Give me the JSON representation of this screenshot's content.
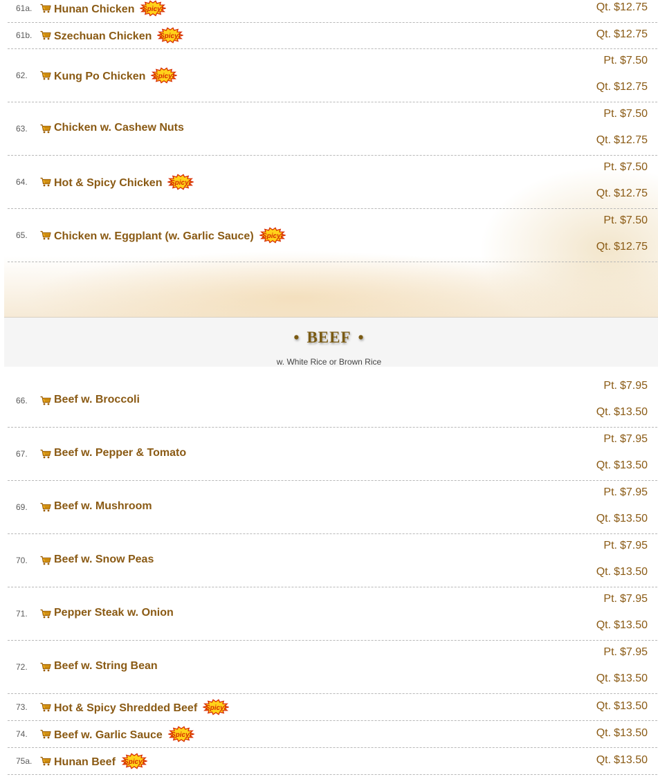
{
  "colors": {
    "item_text": "#8a5a14",
    "section_title": "#7a5a12",
    "spicy_badge": "#d62a00"
  },
  "icons": {
    "cart": "cart-icon",
    "spicy": "spicy-badge-icon"
  },
  "spicy_badge_text": "Spicy!",
  "beef_section": {
    "title": "BEEF",
    "bullet": "•",
    "subtitle": "w. White Rice or Brown Rice"
  },
  "items": [
    {
      "num": "61a.",
      "name": "Hunan Chicken",
      "spicy": true,
      "prices": [
        {
          "size": "Qt.",
          "amount": "$12.75"
        }
      ]
    },
    {
      "num": "61b.",
      "name": "Szechuan Chicken",
      "spicy": true,
      "prices": [
        {
          "size": "Qt.",
          "amount": "$12.75"
        }
      ]
    },
    {
      "num": "62.",
      "name": "Kung Po Chicken",
      "spicy": true,
      "prices": [
        {
          "size": "Pt.",
          "amount": "$7.50"
        },
        {
          "size": "Qt.",
          "amount": "$12.75"
        }
      ]
    },
    {
      "num": "63.",
      "name": "Chicken w. Cashew Nuts",
      "spicy": false,
      "prices": [
        {
          "size": "Pt.",
          "amount": "$7.50"
        },
        {
          "size": "Qt.",
          "amount": "$12.75"
        }
      ]
    },
    {
      "num": "64.",
      "name": "Hot & Spicy Chicken",
      "spicy": true,
      "prices": [
        {
          "size": "Pt.",
          "amount": "$7.50"
        },
        {
          "size": "Qt.",
          "amount": "$12.75"
        }
      ]
    },
    {
      "num": "65.",
      "name": "Chicken w. Eggplant (w. Garlic Sauce)",
      "spicy": true,
      "prices": [
        {
          "size": "Pt.",
          "amount": "$7.50"
        },
        {
          "size": "Qt.",
          "amount": "$12.75"
        }
      ]
    },
    {
      "num": "66.",
      "name": "Beef w. Broccoli",
      "spicy": false,
      "prices": [
        {
          "size": "Pt.",
          "amount": "$7.95"
        },
        {
          "size": "Qt.",
          "amount": "$13.50"
        }
      ]
    },
    {
      "num": "67.",
      "name": "Beef w. Pepper & Tomato",
      "spicy": false,
      "prices": [
        {
          "size": "Pt.",
          "amount": "$7.95"
        },
        {
          "size": "Qt.",
          "amount": "$13.50"
        }
      ]
    },
    {
      "num": "69.",
      "name": "Beef w. Mushroom",
      "spicy": false,
      "prices": [
        {
          "size": "Pt.",
          "amount": "$7.95"
        },
        {
          "size": "Qt.",
          "amount": "$13.50"
        }
      ]
    },
    {
      "num": "70.",
      "name": "Beef w. Snow Peas",
      "spicy": false,
      "prices": [
        {
          "size": "Pt.",
          "amount": "$7.95"
        },
        {
          "size": "Qt.",
          "amount": "$13.50"
        }
      ]
    },
    {
      "num": "71.",
      "name": "Pepper Steak w. Onion",
      "spicy": false,
      "prices": [
        {
          "size": "Pt.",
          "amount": "$7.95"
        },
        {
          "size": "Qt.",
          "amount": "$13.50"
        }
      ]
    },
    {
      "num": "72.",
      "name": "Beef w. String Bean",
      "spicy": false,
      "prices": [
        {
          "size": "Pt.",
          "amount": "$7.95"
        },
        {
          "size": "Qt.",
          "amount": "$13.50"
        }
      ]
    },
    {
      "num": "73.",
      "name": "Hot & Spicy Shredded Beef",
      "spicy": true,
      "prices": [
        {
          "size": "Qt.",
          "amount": "$13.50"
        }
      ]
    },
    {
      "num": "74.",
      "name": "Beef w. Garlic Sauce",
      "spicy": true,
      "prices": [
        {
          "size": "Qt.",
          "amount": "$13.50"
        }
      ]
    },
    {
      "num": "75a.",
      "name": "Hunan Beef",
      "spicy": true,
      "prices": [
        {
          "size": "Qt.",
          "amount": "$13.50"
        }
      ]
    }
  ]
}
